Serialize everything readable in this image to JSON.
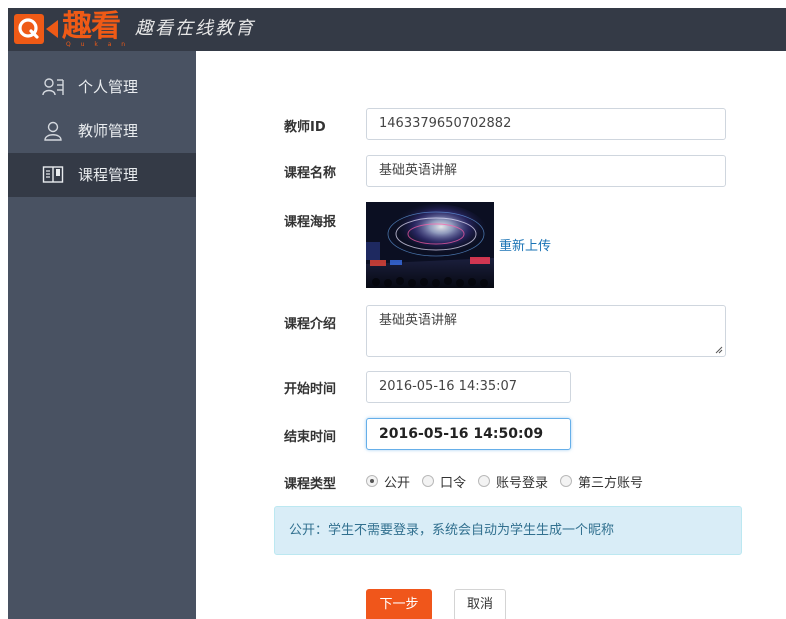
{
  "header": {
    "logo_letter": "Q",
    "logo_brand": "趣看",
    "logo_subtitle": "Q u k a n",
    "site_title": "趣看在线教育"
  },
  "sidebar": {
    "items": [
      {
        "label": "个人管理",
        "icon": "person-list-icon",
        "active": false
      },
      {
        "label": "教师管理",
        "icon": "user-icon",
        "active": false
      },
      {
        "label": "课程管理",
        "icon": "book-icon",
        "active": true
      }
    ]
  },
  "form": {
    "teacher_id": {
      "label": "教师ID",
      "value": "1463379650702882"
    },
    "course_name": {
      "label": "课程名称",
      "value": "基础英语讲解"
    },
    "course_poster": {
      "label": "课程海报",
      "reupload_label": "重新上传"
    },
    "course_intro": {
      "label": "课程介绍",
      "value": "基础英语讲解"
    },
    "start_time": {
      "label": "开始时间",
      "value": "2016-05-16 14:35:07"
    },
    "end_time": {
      "label": "结束时间",
      "value": "2016-05-16 14:50:09"
    },
    "course_type": {
      "label": "课程类型",
      "options": [
        {
          "label": "公开",
          "selected": true
        },
        {
          "label": "口令",
          "selected": false
        },
        {
          "label": "账号登录",
          "selected": false
        },
        {
          "label": "第三方账号",
          "selected": false
        }
      ]
    },
    "hint": "公开：学生不需要登录，系统会自动为学生生成一个昵称"
  },
  "actions": {
    "next_label": "下一步",
    "cancel_label": "取消"
  },
  "colors": {
    "accent": "#f0561b",
    "header_bg": "#343a46",
    "sidebar_bg": "#495262",
    "sidebar_active_bg": "#343a46",
    "link": "#1a73b5",
    "alert_bg": "#d9edf7",
    "alert_text": "#31708f"
  }
}
